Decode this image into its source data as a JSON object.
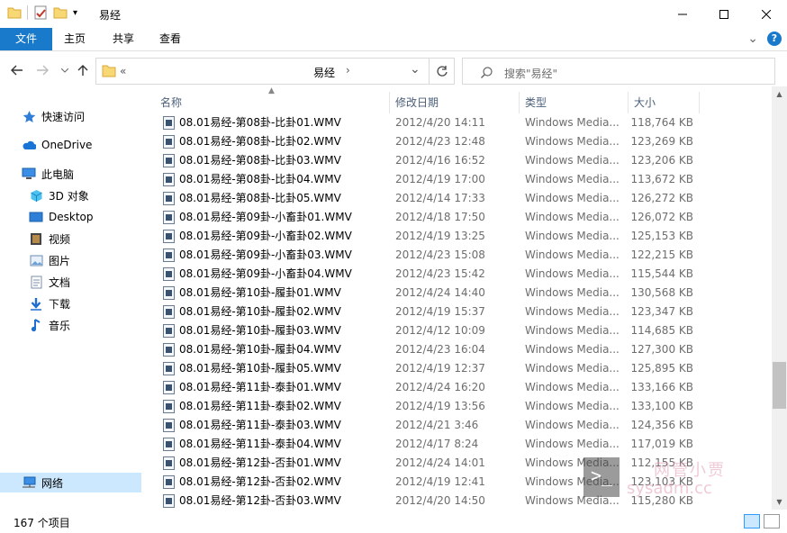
{
  "window": {
    "title": "易经",
    "qat_dropdown": "▾"
  },
  "ribbon": {
    "tabs": [
      "文件",
      "主页",
      "共享",
      "查看"
    ],
    "collapse": "⌄",
    "help": "?"
  },
  "address": {
    "overflow": "«",
    "current": "易经",
    "chevron": "›",
    "dropdown": "⌄",
    "search_placeholder": "搜索\"易经\""
  },
  "sidebar": {
    "items": [
      {
        "label": "快速访问",
        "icon": "star-icon"
      },
      {
        "label": "OneDrive",
        "icon": "cloud-icon"
      },
      {
        "label": "此电脑",
        "icon": "computer-icon"
      },
      {
        "label": "3D 对象",
        "icon": "cube-icon"
      },
      {
        "label": "Desktop",
        "icon": "desktop-icon"
      },
      {
        "label": "视频",
        "icon": "video-icon"
      },
      {
        "label": "图片",
        "icon": "picture-icon"
      },
      {
        "label": "文档",
        "icon": "document-icon"
      },
      {
        "label": "下载",
        "icon": "download-icon"
      },
      {
        "label": "音乐",
        "icon": "music-icon"
      },
      {
        "label": "网络",
        "icon": "network-icon"
      }
    ]
  },
  "columns": {
    "name": "名称",
    "date": "修改日期",
    "type": "类型",
    "size": "大小"
  },
  "files": [
    {
      "name": "08.01易经-第08卦-比卦01.WMV",
      "date": "2012/4/20 14:11",
      "type": "Windows Media...",
      "size": "118,764 KB"
    },
    {
      "name": "08.01易经-第08卦-比卦02.WMV",
      "date": "2012/4/23 12:48",
      "type": "Windows Media...",
      "size": "123,269 KB"
    },
    {
      "name": "08.01易经-第08卦-比卦03.WMV",
      "date": "2012/4/16 16:52",
      "type": "Windows Media...",
      "size": "123,206 KB"
    },
    {
      "name": "08.01易经-第08卦-比卦04.WMV",
      "date": "2012/4/19 17:00",
      "type": "Windows Media...",
      "size": "113,672 KB"
    },
    {
      "name": "08.01易经-第08卦-比卦05.WMV",
      "date": "2012/4/14 17:33",
      "type": "Windows Media...",
      "size": "126,272 KB"
    },
    {
      "name": "08.01易经-第09卦-小畜卦01.WMV",
      "date": "2012/4/18 17:50",
      "type": "Windows Media...",
      "size": "126,072 KB"
    },
    {
      "name": "08.01易经-第09卦-小畜卦02.WMV",
      "date": "2012/4/19 13:25",
      "type": "Windows Media...",
      "size": "125,153 KB"
    },
    {
      "name": "08.01易经-第09卦-小畜卦03.WMV",
      "date": "2012/4/23 15:08",
      "type": "Windows Media...",
      "size": "122,215 KB"
    },
    {
      "name": "08.01易经-第09卦-小畜卦04.WMV",
      "date": "2012/4/23 15:42",
      "type": "Windows Media...",
      "size": "115,544 KB"
    },
    {
      "name": "08.01易经-第10卦-履卦01.WMV",
      "date": "2012/4/24 14:40",
      "type": "Windows Media...",
      "size": "130,568 KB"
    },
    {
      "name": "08.01易经-第10卦-履卦02.WMV",
      "date": "2012/4/19 15:37",
      "type": "Windows Media...",
      "size": "123,347 KB"
    },
    {
      "name": "08.01易经-第10卦-履卦03.WMV",
      "date": "2012/4/12 10:09",
      "type": "Windows Media...",
      "size": "114,685 KB"
    },
    {
      "name": "08.01易经-第10卦-履卦04.WMV",
      "date": "2012/4/23 16:04",
      "type": "Windows Media...",
      "size": "127,300 KB"
    },
    {
      "name": "08.01易经-第10卦-履卦05.WMV",
      "date": "2012/4/19 12:37",
      "type": "Windows Media...",
      "size": "125,895 KB"
    },
    {
      "name": "08.01易经-第11卦-泰卦01.WMV",
      "date": "2012/4/24 16:20",
      "type": "Windows Media...",
      "size": "133,166 KB"
    },
    {
      "name": "08.01易经-第11卦-泰卦02.WMV",
      "date": "2012/4/19 13:56",
      "type": "Windows Media...",
      "size": "133,100 KB"
    },
    {
      "name": "08.01易经-第11卦-泰卦03.WMV",
      "date": "2012/4/21 3:46",
      "type": "Windows Media...",
      "size": "124,356 KB"
    },
    {
      "name": "08.01易经-第11卦-泰卦04.WMV",
      "date": "2012/4/17 8:24",
      "type": "Windows Media...",
      "size": "117,019 KB"
    },
    {
      "name": "08.01易经-第12卦-否卦01.WMV",
      "date": "2012/4/24 14:01",
      "type": "Windows Media...",
      "size": "112,155 KB"
    },
    {
      "name": "08.01易经-第12卦-否卦02.WMV",
      "date": "2012/4/19 12:41",
      "type": "Windows Media...",
      "size": "123,103 KB"
    },
    {
      "name": "08.01易经-第12卦-否卦03.WMV",
      "date": "2012/4/20 14:50",
      "type": "Windows Media...",
      "size": "115,280 KB"
    }
  ],
  "status": {
    "count": "167 个项目"
  },
  "watermark": {
    "line1": "网管小贾",
    "line2": "sysadm.cc"
  }
}
